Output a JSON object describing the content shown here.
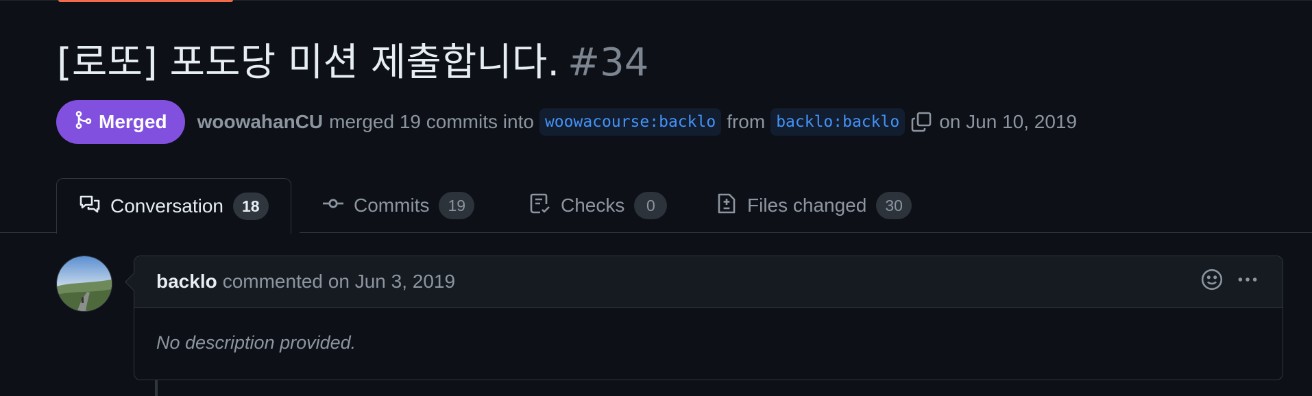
{
  "pr": {
    "title": "[로또] 포도당 미션 제출합니다.",
    "number": "#34",
    "state": "Merged",
    "author": "woowahanCU",
    "action_text": "merged 19 commits into",
    "base_branch": "woowacourse:backlo",
    "from_text": "from",
    "head_branch": "backlo:backlo",
    "date_text": "on Jun 10, 2019"
  },
  "tabs": [
    {
      "label": "Conversation",
      "count": "18",
      "icon": "comment-discussion-icon",
      "active": true
    },
    {
      "label": "Commits",
      "count": "19",
      "icon": "git-commit-icon",
      "active": false
    },
    {
      "label": "Checks",
      "count": "0",
      "icon": "checklist-icon",
      "active": false
    },
    {
      "label": "Files changed",
      "count": "30",
      "icon": "file-diff-icon",
      "active": false
    }
  ],
  "comment": {
    "author": "backlo",
    "meta": "commented on Jun 3, 2019",
    "body": "No description provided."
  },
  "colors": {
    "background": "#0d1117",
    "merged": "#8250df",
    "branch_text": "#4493f8",
    "accent_top": "#f06b4b"
  }
}
